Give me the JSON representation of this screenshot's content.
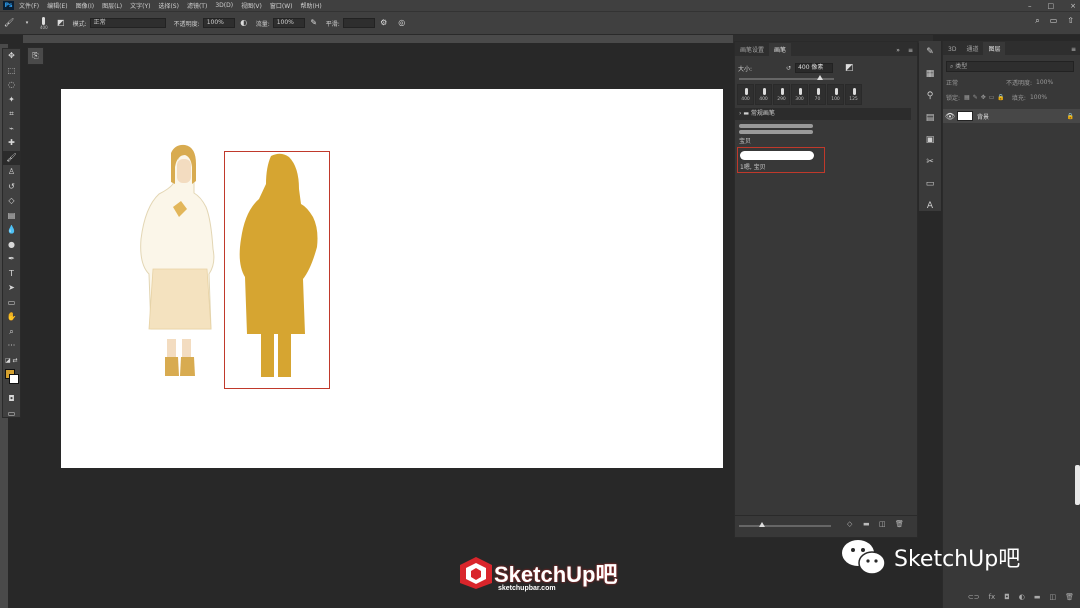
{
  "menubar": {
    "app_icon": "Ps",
    "items": [
      "文件(F)",
      "编辑(E)",
      "图像(I)",
      "图层(L)",
      "文字(Y)",
      "选择(S)",
      "滤镜(T)",
      "3D(D)",
      "视图(V)",
      "窗口(W)",
      "帮助(H)"
    ]
  },
  "options": {
    "brush_size": "400",
    "mode_label": "模式:",
    "mode_value": "正常",
    "opacity_label": "不透明度:",
    "opacity_value": "100%",
    "flow_label": "流量:",
    "flow_value": "100%",
    "smooth_label": "平滑:"
  },
  "brush_panel": {
    "tabs": [
      "画笔设置",
      "画笔"
    ],
    "size_label": "大小:",
    "size_value": "400 像素",
    "presets": [
      "400",
      "400",
      "290",
      "300",
      "70",
      "100",
      "125"
    ],
    "folder_label": "常规画笔",
    "strokes": [
      {
        "name": "宝贝"
      },
      {
        "name": "1嗯, 宝贝"
      }
    ]
  },
  "layers_panel": {
    "tabs": [
      "3D",
      "通道",
      "图层"
    ],
    "filter_placeholder": "类型",
    "blend_mode": "正常",
    "opacity_label": "不透明度:",
    "opacity_value": "100%",
    "lock_label": "锁定:",
    "fill_label": "填充:",
    "fill_value": "100%",
    "layer_name": "背景"
  },
  "watermark": {
    "text": "SketchUp吧"
  },
  "logo": {
    "text": "SketchUp吧",
    "url": "sketchupbar.com"
  },
  "colors": {
    "foreground": "#d4a02f",
    "background": "#ffffff",
    "selection": "#c0392b"
  }
}
